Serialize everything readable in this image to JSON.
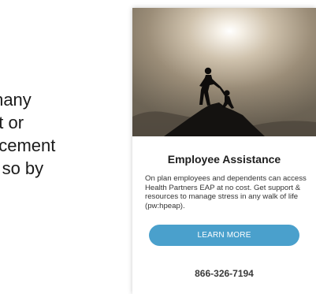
{
  "left_text": {
    "lines": [
      "many",
      "nt or",
      "ncement",
      "do so by"
    ]
  },
  "card": {
    "image_alt_icon": "helping-hand-silhouette-icon",
    "title": "Employee Assistance",
    "description": "On plan employees and dependents can access Health Partners EAP at no cost. Get support & resources to manage stress in any walk of life (pw:hpeap).",
    "cta_label": "LEARN MORE",
    "phone": "866-326-7194"
  },
  "colors": {
    "cta_background": "#4aa0cc",
    "title_text": "#1e1e1e"
  }
}
